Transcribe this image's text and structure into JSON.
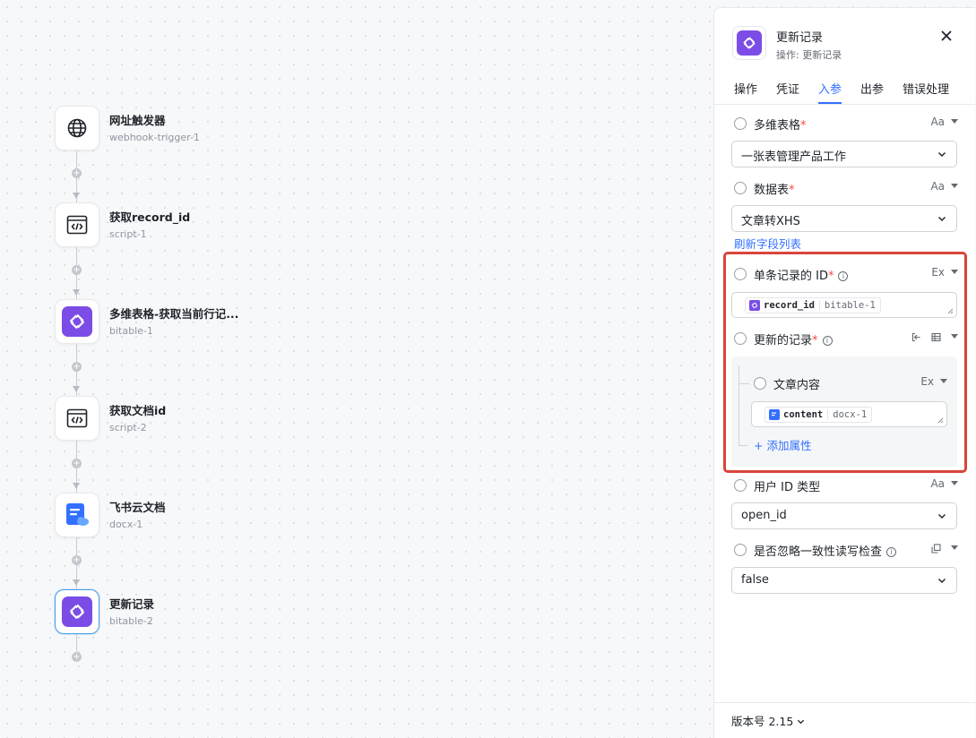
{
  "flow": {
    "nodes": [
      {
        "title": "网址触发器",
        "subtitle": "webhook-trigger-1",
        "icon": "globe-icon"
      },
      {
        "title": "获取record_id",
        "subtitle": "script-1",
        "icon": "code-script-icon"
      },
      {
        "title": "多维表格-获取当前行记...",
        "subtitle": "bitable-1",
        "icon": "bitable-icon"
      },
      {
        "title": "获取文档id",
        "subtitle": "script-2",
        "icon": "code-script-icon"
      },
      {
        "title": "飞书云文档",
        "subtitle": "docx-1",
        "icon": "cloud-doc-icon"
      },
      {
        "title": "更新记录",
        "subtitle": "bitable-2",
        "icon": "bitable-icon",
        "active": true
      }
    ],
    "plus_symbol": "+"
  },
  "panel": {
    "title": "更新记录",
    "subtitle": "操作: 更新记录",
    "tabs": [
      "操作",
      "凭证",
      "入参",
      "出参",
      "错误处理"
    ],
    "active_tab": "入参",
    "fields": {
      "table": {
        "label": "多维表格",
        "required": "*",
        "type": "Aa",
        "value": "一张表管理产品工作"
      },
      "sheet": {
        "label": "数据表",
        "required": "*",
        "type": "Aa",
        "value": "文章转XHS"
      },
      "refresh_link": "刷新字段列表",
      "record_id": {
        "label": "单条记录的 ID",
        "required": "*",
        "info": "i",
        "type": "Ex",
        "chip_name": "record_id",
        "chip_source": "bitable-1"
      },
      "updated_record": {
        "label": "更新的记录",
        "required": "*",
        "info": "i"
      },
      "article_content": {
        "label": "文章内容",
        "type": "Ex",
        "chip_name": "content",
        "chip_source": "docx-1"
      },
      "add_attribute": "+ 添加属性",
      "user_id_type": {
        "label": "用户 ID 类型",
        "type": "Aa",
        "value": "open_id"
      },
      "ignore_consistency": {
        "label": "是否忽略一致性读写检查",
        "info": "i",
        "value": "false"
      }
    },
    "version": "版本号 2.15"
  },
  "colors": {
    "accent": "#3370ff",
    "bitable_purple": "#7b4de6",
    "highlight_red": "#d9453b",
    "required_red": "#f54a45"
  }
}
